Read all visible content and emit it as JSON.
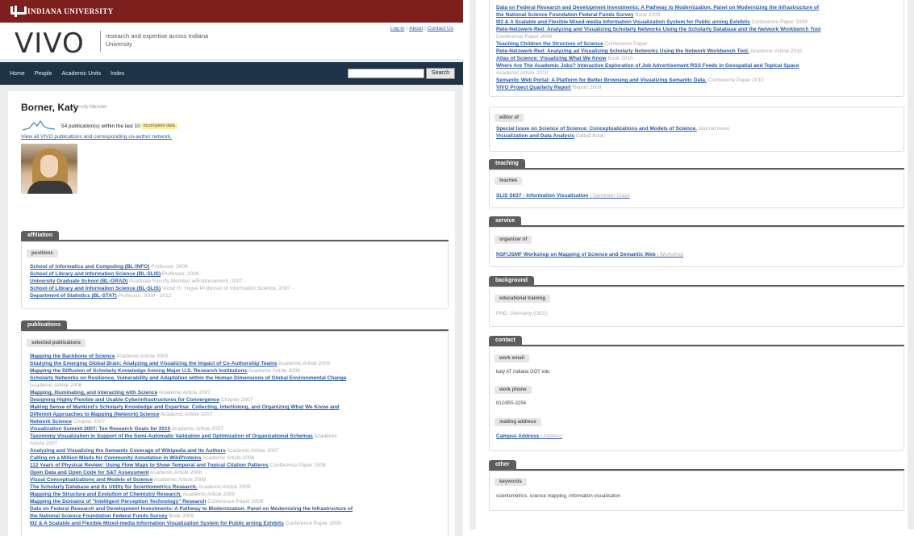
{
  "header": {
    "iu_label": "INDIANA UNIVERSITY",
    "logo": "VIVO",
    "tagline": "research and expertise across Indiana University",
    "top_links": [
      "Log in",
      "About",
      "Contact Us"
    ]
  },
  "nav": {
    "items": [
      "Home",
      "People",
      "Academic Units",
      "Index"
    ],
    "search_button": "Search",
    "search_value": ""
  },
  "profile": {
    "name": "Borner, Katy",
    "title": "Faculty Member",
    "pub_count_text": "54 publication(s) within the last 10 years",
    "incomplete_badge": "incomplete data",
    "coauthor_link": "View all VIVO publications and corresponding co-author network."
  },
  "affiliation": {
    "tab": "affiliation",
    "sub_label": "positions",
    "items": [
      {
        "link": "School of Informatics and Computing (BL-INFO)",
        "meta": "Professor, 2009 -"
      },
      {
        "link": "School of Library and Information Science (BL-SLIS)",
        "meta": "Professor, 2009 -"
      },
      {
        "link": "University Graduate School (BL-GRAD)",
        "meta": "Graduate Faculty Member w/Endorsement, 2007 -"
      },
      {
        "link": "School of Library and Information Science (BL-SLIS)",
        "meta": "Victor H. Yngve Professor of Information Science, 2007 -"
      },
      {
        "link": "Department of Statistics (BL-STAT)",
        "meta": "Professor, 2009 - 2012"
      }
    ]
  },
  "publications": {
    "tab": "publications",
    "sub_label": "selected publications",
    "items": [
      {
        "link": "Mapping the Backbone of Science",
        "meta": "Academic Article 2005"
      },
      {
        "link": "Studying the Emerging Global Brain: Analyzing and Visualizing the Impact of Co-Authorship Teams",
        "meta": "Academic Article 2005"
      },
      {
        "link": "Mapping the Diffusion of Scholarly Knowledge Among Major U.S. Research Institutions",
        "meta": "Academic Article 2006"
      },
      {
        "link": "Scholarly Networks on Resilience, Vulnerability and Adaptation within the Human Dimensions of Global Environmental Change",
        "meta": ""
      },
      {
        "link": "",
        "meta": "Academic Article 2006"
      },
      {
        "link": "Mapping, Illuminating, and Interacting with Science",
        "meta": "Academic Article 2007"
      },
      {
        "link": "Designing Highly Flexible and Usable Cyberinfrastructures for Convergence",
        "meta": "Chapter 2007"
      },
      {
        "link": "Making Sense of Mankind's Scholarly Knowledge and Expertise: Collecting, Interlinking, and Organizing What We Know and",
        "meta": ""
      },
      {
        "link": "Different Approaches to Mapping (Network) Science",
        "meta": "Academic Article 2007"
      },
      {
        "link": "Network Science",
        "meta": "Chapter 2007"
      },
      {
        "link": "Visualization Summit 2007: Ten Research Goals for 2010",
        "meta": "Academic Article 2007"
      },
      {
        "link": "Taxonomy Visualization in Support of the Semi-Automatic Validation and Optimization of Organizational Schemas",
        "meta": "Academic"
      },
      {
        "link": "",
        "meta": "Article 2007"
      },
      {
        "link": "Analyzing and Visualizing the Semantic Coverage of Wikipedia and Its Authors",
        "meta": "Academic Article 2007"
      },
      {
        "link": "Calling on a Million Minds for Community Annotation in WikiProteins",
        "meta": "Academic Article 2008"
      },
      {
        "link": "112 Years of Physical Review: Using Flow Maps to Show Temporal and Topical Citation Patterns",
        "meta": "Conference Paper 2008"
      },
      {
        "link": "Open Data and Open Code for S&T Assessment",
        "meta": "Academic Article 2008"
      },
      {
        "link": "Visual Conceptualizations and Models of Science",
        "meta": "Academic Article 2009"
      },
      {
        "link": "The Scholarly Database and Its Utility for Scientometrics Research.",
        "meta": "Academic Article 2009"
      },
      {
        "link": "Mapping the Structure and Evolution of Chemistry Research.",
        "meta": "Academic Article 2009"
      },
      {
        "link": "Mapping the Domains of \"Intelligent Perception Technology\" Research",
        "meta": "Conference Paper 2009"
      },
      {
        "link": "Data on Federal Research and Development Investments: A Pathway to Modernization. Panel on Modernizing the Infrastructure of",
        "meta": ""
      },
      {
        "link": "the National Science Foundation Federal Funds Survey",
        "meta": "Book 2009"
      },
      {
        "link": "I02 & A Scalable and Flexible Mixed-media Information Visualization System for Public arning Exhibits",
        "meta": "Conference Paper 2009"
      }
    ]
  },
  "right_publications": {
    "items": [
      {
        "link": "Data on Federal Research and Development Investments: A Pathway to Modernization. Panel on Modernizing the Infrastructure of",
        "meta": ""
      },
      {
        "link": "the National Science Foundation Federal Funds Survey",
        "meta": "Book 2009"
      },
      {
        "link": "I02 & A Scalable and Flexible Mixed-media Information Visualization System for Public arning Exhibits",
        "meta": "Conference Paper 2009"
      },
      {
        "link": "Rete-Netzwerk-Red: Analyzing and Visualizing Scholarly Networks Using the Scholarly Database and the Network Workbench Tool",
        "meta": ""
      },
      {
        "link": "",
        "meta": "Conference Paper 2009"
      },
      {
        "link": "Teaching Children the Structure of Science",
        "meta": "Conference Paper"
      },
      {
        "link": "Rete-Netzwerk-Red: Analyzing ad Visualizing Scholarly Networks Using the Network Workbench Tool.",
        "meta": "Academic Article 2010"
      },
      {
        "link": "Atlas of Science: Visualizing What We Know",
        "meta": "Book 2010"
      },
      {
        "link": "Where Are The Academic Jobs? Interactive Exploration of Job Advertisement RSS Feeds in Geospatial and Topical Space",
        "meta": ""
      },
      {
        "link": "",
        "meta": "Academic Article 2010"
      },
      {
        "link": "Semantic Web Portal: A Platform for Better Browsing and Visualizing Semantic Data.",
        "meta": "Conference Paper 2010"
      },
      {
        "link": "VIVO Project Quarterly Report",
        "meta": "Report 2009"
      }
    ],
    "editor_label": "editor of",
    "editor_items": [
      {
        "link": "Special Issue on Science of Science: Conceptualizations and Models of Science.",
        "meta": "Journal Issue"
      },
      {
        "link": "Visualization and Data Analysis",
        "meta": "Edited Book"
      }
    ]
  },
  "teaching": {
    "tab": "teaching",
    "sub_label": "teaches",
    "link": "SLIS S637 - Information Visualization",
    "meta": "Semester Class"
  },
  "service": {
    "tab": "service",
    "sub_label": "organizer of",
    "link": "NSF/JSMF Workshop on Mapping of Science and Semantic Web",
    "meta": "Workshop"
  },
  "background": {
    "tab": "background",
    "sub_label": "educational training",
    "value": "PHD, Germany (DEU)"
  },
  "contact": {
    "tab": "contact",
    "email_label": "work email",
    "email": "katy AT indiana DOT edu",
    "phone_label": "work phone",
    "phone": "812/855-3256",
    "address_label": "mailing address",
    "address_link": "Campus Address",
    "address_meta": "Address"
  },
  "other": {
    "tab": "other",
    "sub_label": "keywords",
    "keywords": "scientometrics, science mapping, information visualization"
  },
  "colors": {
    "iu_red": "#7d1f1d",
    "navbar": "#1e3346",
    "link": "#2b5aa6",
    "section_tab": "#5d5d5d"
  }
}
